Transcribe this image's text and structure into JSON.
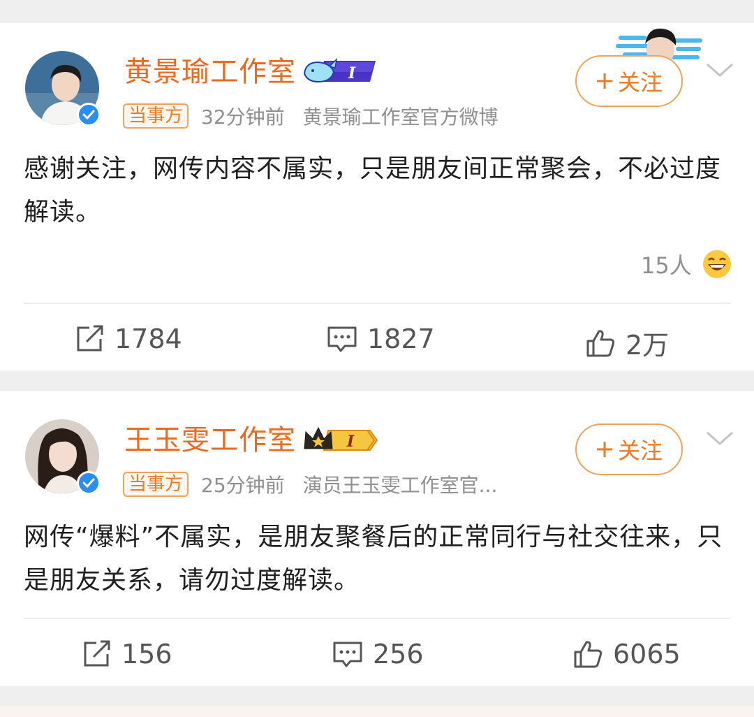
{
  "posts": [
    {
      "name": "黄景瑜工作室",
      "tag": "当事方",
      "time": "32分钟前",
      "source": "黄景瑜工作室官方微博",
      "follow_label": "关注",
      "content": "感谢关注，网传内容不属实，只是朋友间正常聚会，不必过度解读。",
      "reaction_count": "15人",
      "reposts": "1784",
      "comments": "1827",
      "likes": "2万"
    },
    {
      "name": "王玉雯工作室",
      "tag": "当事方",
      "time": "25分钟前",
      "source": "演员王玉雯工作室官...",
      "follow_label": "关注",
      "content": "网传“爆料”不属实，是朋友聚餐后的正常同行与社交往来，只是朋友关系，请勿过度解读。",
      "reposts": "156",
      "comments": "256",
      "likes": "6065"
    }
  ],
  "level_badge_text": "I",
  "colors": {
    "name": "#ec6a1d",
    "follow": "#ec7a25",
    "verified": "#2a8df0",
    "background": "#efefef"
  },
  "icons": [
    "verified-icon",
    "level-badge-whale",
    "level-badge-crown",
    "plus-icon",
    "chevron-down-icon",
    "repost-icon",
    "comment-icon",
    "like-icon",
    "laugh-emoji-icon"
  ]
}
